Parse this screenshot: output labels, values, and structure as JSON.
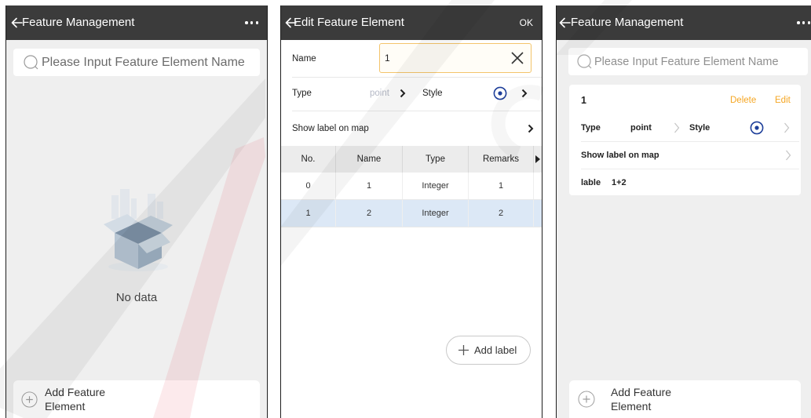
{
  "colors": {
    "header_bg": "#3b3b3b",
    "accent_orange": "#f5a623",
    "style_icon_blue": "#1e3f9a",
    "selected_row_bg": "#dce8f6",
    "input_border": "#f3c46b"
  },
  "screen_list_empty": {
    "header": {
      "title": "Feature Management",
      "back_icon": "back-arrow-icon",
      "menu_icon": "more-icon"
    },
    "search": {
      "placeholder": "Please Input Feature Element Name",
      "icon": "search-icon"
    },
    "empty_state": {
      "icon": "empty-box-icon",
      "text": "No data"
    },
    "add_button": {
      "icon": "plus-circle-icon",
      "label": "Add Feature Element"
    }
  },
  "screen_edit": {
    "header": {
      "title": "Edit Feature Element",
      "back_icon": "back-arrow-icon",
      "ok_label": "OK"
    },
    "name_field": {
      "label": "Name",
      "value": "1",
      "clear_icon": "clear-icon"
    },
    "type_field": {
      "label": "Type",
      "value": "point"
    },
    "style_field": {
      "label": "Style",
      "icon": "point-style-icon"
    },
    "show_label": {
      "label": "Show label on map"
    },
    "attribute_table": {
      "columns": [
        "No.",
        "Name",
        "Type",
        "Remarks"
      ],
      "rows": [
        [
          "0",
          "1",
          "Integer",
          "1"
        ],
        [
          "1",
          "2",
          "Integer",
          "2"
        ]
      ],
      "selected_row_index": 1
    },
    "add_label_button": {
      "icon": "plus-icon",
      "label": "Add label"
    }
  },
  "screen_list_filled": {
    "header": {
      "title": "Feature Management",
      "back_icon": "back-arrow-icon",
      "menu_icon": "more-icon"
    },
    "search": {
      "placeholder": "Please Input Feature Element Name",
      "icon": "search-icon"
    },
    "feature_card": {
      "name": "1",
      "delete_label": "Delete",
      "edit_label": "Edit",
      "type_label": "Type",
      "type_value": "point",
      "style_label": "Style",
      "style_icon": "point-style-icon",
      "show_label": "Show label on map",
      "label_key": "lable",
      "label_value": "1+2"
    },
    "add_button": {
      "icon": "plus-circle-icon",
      "label": "Add Feature Element"
    }
  }
}
